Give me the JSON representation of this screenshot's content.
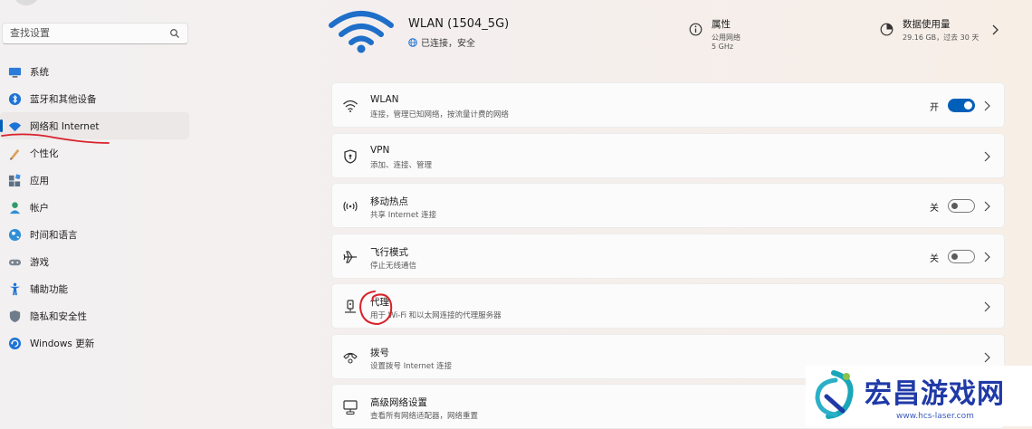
{
  "sidebar": {
    "search_placeholder": "查找设置",
    "items": [
      {
        "label": "系统",
        "icon": "monitor-icon"
      },
      {
        "label": "蓝牙和其他设备",
        "icon": "bluetooth-icon"
      },
      {
        "label": "网络和 Internet",
        "icon": "wifi-icon",
        "active": true
      },
      {
        "label": "个性化",
        "icon": "pen-icon"
      },
      {
        "label": "应用",
        "icon": "apps-icon"
      },
      {
        "label": "帐户",
        "icon": "person-icon"
      },
      {
        "label": "时间和语言",
        "icon": "globe-icon"
      },
      {
        "label": "游戏",
        "icon": "gamepad-icon"
      },
      {
        "label": "辅助功能",
        "icon": "accessibility-icon"
      },
      {
        "label": "隐私和安全性",
        "icon": "shield-icon"
      },
      {
        "label": "Windows 更新",
        "icon": "update-icon"
      }
    ]
  },
  "header": {
    "network_name": "WLAN (1504_5G)",
    "network_status": "已连接，安全",
    "properties": {
      "title": "属性",
      "line1": "公用网络",
      "line2": "5 GHz"
    },
    "data_usage": {
      "title": "数据使用量",
      "line1": "29.16 GB，过去 30 天"
    }
  },
  "cards": [
    {
      "title": "WLAN",
      "subtitle": "连接，管理已知网络，按流量计费的网络",
      "icon": "wifi-icon",
      "toggle_label": "开",
      "toggle_on": true
    },
    {
      "title": "VPN",
      "subtitle": "添加、连接、管理",
      "icon": "vpn-shield-icon"
    },
    {
      "title": "移动热点",
      "subtitle": "共享 Internet 连接",
      "icon": "hotspot-icon",
      "toggle_label": "关",
      "toggle_on": false
    },
    {
      "title": "飞行模式",
      "subtitle": "停止无线通信",
      "icon": "airplane-icon",
      "toggle_label": "关",
      "toggle_on": false
    },
    {
      "title": "代理",
      "subtitle": "用于 Wi-Fi 和以太网连接的代理服务器",
      "icon": "proxy-icon"
    },
    {
      "title": "拨号",
      "subtitle": "设置拨号 Internet 连接",
      "icon": "dialup-icon"
    },
    {
      "title": "高级网络设置",
      "subtitle": "查看所有网络适配器，网络重置",
      "icon": "advanced-network-icon"
    }
  ],
  "watermark": {
    "text": "宏昌游戏网",
    "url": "www.hcs-laser.com"
  },
  "colors": {
    "accent": "#005fb8",
    "annotation": "#d9222a",
    "watermark": "#1f3aa7"
  }
}
